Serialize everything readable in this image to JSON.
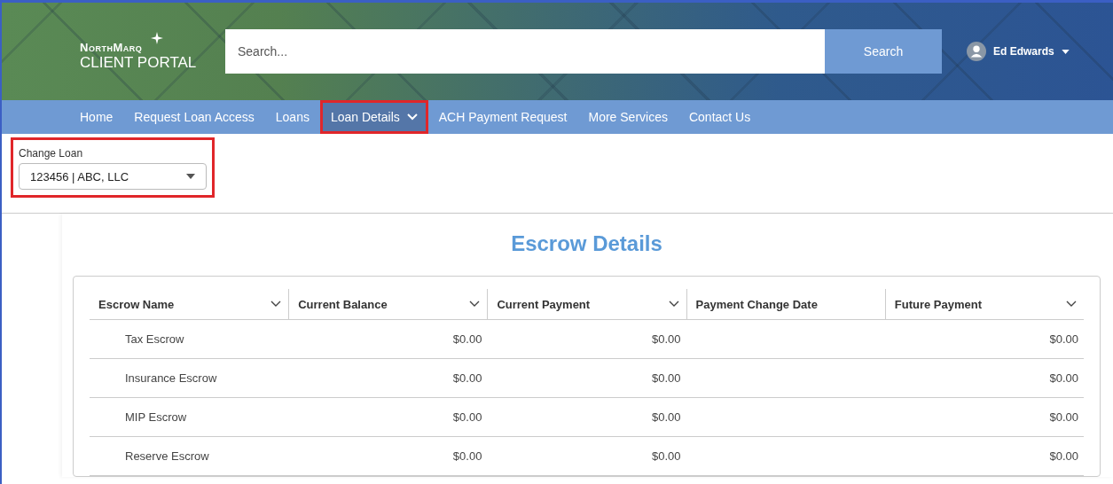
{
  "header": {
    "logo_top": "NorthMarq",
    "logo_bottom": "CLIENT PORTAL",
    "search": {
      "placeholder": "Search..."
    },
    "search_button": "Search",
    "user": {
      "name": "Ed Edwards"
    }
  },
  "nav": [
    {
      "label": "Home",
      "selected": false,
      "highlighted": false,
      "has_menu": false
    },
    {
      "label": "Request Loan Access",
      "selected": false,
      "highlighted": false,
      "has_menu": false
    },
    {
      "label": "Loans",
      "selected": false,
      "highlighted": false,
      "has_menu": false
    },
    {
      "label": "Loan Details",
      "selected": true,
      "highlighted": true,
      "has_menu": true
    },
    {
      "label": "ACH Payment Request",
      "selected": false,
      "highlighted": false,
      "has_menu": false
    },
    {
      "label": "More Services",
      "selected": false,
      "highlighted": false,
      "has_menu": false
    },
    {
      "label": "Contact Us",
      "selected": false,
      "highlighted": false,
      "has_menu": false
    }
  ],
  "change_loan": {
    "label": "Change Loan",
    "value": "123456 | ABC, LLC",
    "highlighted": true
  },
  "title": "Escrow Details",
  "table": {
    "columns": [
      {
        "label": "Escrow Name",
        "sortable": true
      },
      {
        "label": "Current Balance",
        "sortable": true
      },
      {
        "label": "Current Payment",
        "sortable": true
      },
      {
        "label": "Payment Change Date",
        "sortable": false
      },
      {
        "label": "Future Payment",
        "sortable": true
      }
    ],
    "rows": [
      [
        "Tax Escrow",
        "$0.00",
        "$0.00",
        "",
        "$0.00"
      ],
      [
        "Insurance Escrow",
        "$0.00",
        "$0.00",
        "",
        "$0.00"
      ],
      [
        "MIP Escrow",
        "$0.00",
        "$0.00",
        "",
        "$0.00"
      ],
      [
        "Reserve Escrow",
        "$0.00",
        "$0.00",
        "",
        "$0.00"
      ]
    ]
  }
}
